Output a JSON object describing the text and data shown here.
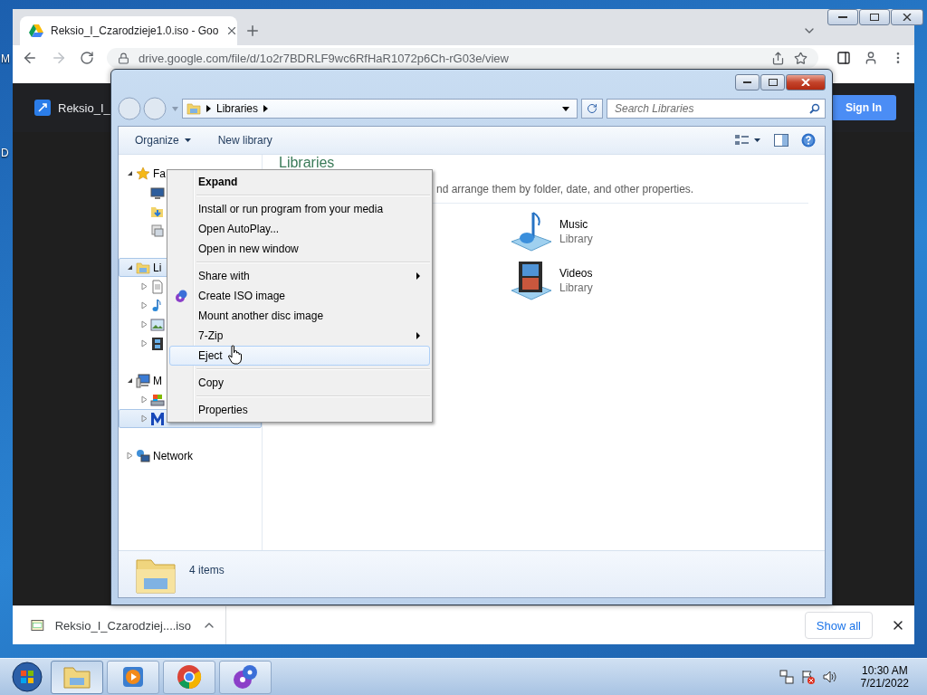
{
  "desktop": {
    "labels": [
      "M",
      "D"
    ]
  },
  "browser": {
    "tabs": [
      {
        "title": "Reksio_I_Czarodzieje1.0.iso - Goo",
        "selected": true
      }
    ],
    "url": "drive.google.com/file/d/1o2r7BDRLF9wc6RfHaR1072p6Ch-rG03e/view",
    "page": {
      "title": "Reksio_I_",
      "sign_in": "Sign In"
    },
    "download_bar": {
      "file": "Reksio_I_Czarodziej....iso",
      "show_all": "Show all"
    }
  },
  "explorer": {
    "address": [
      "Libraries"
    ],
    "search": {
      "placeholder": "Search Libraries"
    },
    "toolbar": [
      {
        "label": "Organize",
        "kind": "menu"
      },
      {
        "label": "New library",
        "kind": "button"
      }
    ],
    "tree": [
      {
        "label": "Fa",
        "kind": "favorites",
        "expanded": true,
        "selected": false,
        "children": [
          {
            "kind": "desktop",
            "selected": false
          },
          {
            "kind": "downloads",
            "selected": false
          },
          {
            "kind": "places",
            "selected": false
          }
        ]
      },
      {
        "label": "Li",
        "kind": "library",
        "expanded": true,
        "selected": true,
        "children": [
          {
            "kind": "documents",
            "expanded": false,
            "selected": false
          },
          {
            "kind": "music",
            "expanded": false,
            "selected": false
          },
          {
            "kind": "pictures",
            "expanded": false,
            "selected": false
          },
          {
            "kind": "videos",
            "expanded": false,
            "selected": false
          }
        ]
      },
      {
        "label": "M",
        "kind": "computer",
        "expanded": true,
        "selected": false,
        "children": [
          {
            "kind": "drive",
            "expanded": false,
            "selected": false
          },
          {
            "kind": "disc",
            "expanded": false,
            "selected": true
          }
        ]
      },
      {
        "label": "Network",
        "kind": "network",
        "expanded": false,
        "selected": false
      }
    ],
    "heading": "Libraries",
    "description": "nd arrange them by folder, date, and other properties.",
    "items": [
      {
        "name": "Music",
        "type": "Library",
        "kind": "music"
      },
      {
        "name": "Videos",
        "type": "Library",
        "kind": "videos"
      }
    ],
    "status": "4 items"
  },
  "context_menu": {
    "groups": [
      [
        {
          "label": "Expand",
          "kind": "plain",
          "default": true,
          "submenu": false,
          "hovered": false
        }
      ],
      [
        {
          "label": "Install or run program from your media",
          "kind": "plain",
          "default": false,
          "submenu": false,
          "hovered": false
        },
        {
          "label": "Open AutoPlay...",
          "kind": "plain",
          "default": false,
          "submenu": false,
          "hovered": false
        },
        {
          "label": "Open in new window",
          "kind": "plain",
          "default": false,
          "submenu": false,
          "hovered": false
        }
      ],
      [
        {
          "label": "Share with",
          "kind": "plain",
          "default": false,
          "submenu": true,
          "hovered": false
        },
        {
          "label": "Create ISO image",
          "kind": "icon",
          "default": false,
          "submenu": false,
          "hovered": false
        },
        {
          "label": "Mount another disc image",
          "kind": "plain",
          "default": false,
          "submenu": false,
          "hovered": false
        },
        {
          "label": "7-Zip",
          "kind": "plain",
          "default": false,
          "submenu": true,
          "hovered": false
        },
        {
          "label": "Eject",
          "kind": "plain",
          "default": false,
          "submenu": false,
          "hovered": true
        }
      ],
      [
        {
          "label": "Copy",
          "kind": "plain",
          "default": false,
          "submenu": false,
          "hovered": false
        }
      ],
      [
        {
          "label": "Properties",
          "kind": "plain",
          "default": false,
          "submenu": false,
          "hovered": false
        }
      ]
    ]
  },
  "taskbar": {
    "buttons": [
      {
        "kind": "explorer",
        "selected": true
      },
      {
        "kind": "media",
        "selected": false
      },
      {
        "kind": "chrome",
        "selected": false
      },
      {
        "kind": "disc",
        "selected": false
      }
    ],
    "time": "10:30 AM",
    "date": "7/21/2022"
  }
}
